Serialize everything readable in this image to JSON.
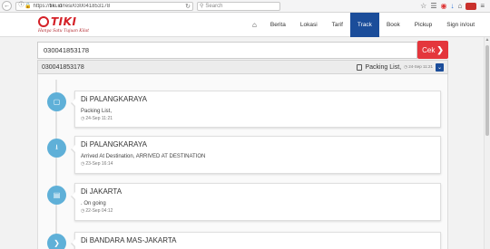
{
  "browser": {
    "url_prefix": "https://",
    "url_host": "tiki.id",
    "url_path": "/resi/030041853178",
    "search_placeholder": "Search"
  },
  "site": {
    "brand": "TIKI",
    "tagline": "Hanya Satu Tujuan Kilat",
    "nav": [
      {
        "label": "Berita"
      },
      {
        "label": "Lokasi"
      },
      {
        "label": "Tarif"
      },
      {
        "label": "Track",
        "active": true
      },
      {
        "label": "Book"
      },
      {
        "label": "Pickup"
      },
      {
        "label": "Sign in/out"
      }
    ],
    "accent_color": "#1b4d9a",
    "brand_color": "#d42027"
  },
  "tracking": {
    "input_value": "030041853178",
    "check_label": "Cek"
  },
  "result": {
    "number": "030041853178",
    "status": "Packing List,",
    "status_time": "24-Sep 11:21"
  },
  "events": [
    {
      "location": "Di PALANGKARAYA",
      "description": "Packing List,",
      "time": "24-Sep 11:21",
      "icon": "clipboard-icon"
    },
    {
      "location": "Di PALANGKARAYA",
      "description": "Arrived At Destination, ARRIVED AT DESTINATION",
      "time": "23-Sep 16:14",
      "icon": "download-icon"
    },
    {
      "location": "Di JAKARTA",
      "description": ". On going",
      "time": "22-Sep 04:12",
      "icon": "document-icon"
    },
    {
      "location": "Di BANDARA MAS-JAKARTA",
      "description": "",
      "time": "",
      "icon": "chevron-right-icon"
    }
  ]
}
